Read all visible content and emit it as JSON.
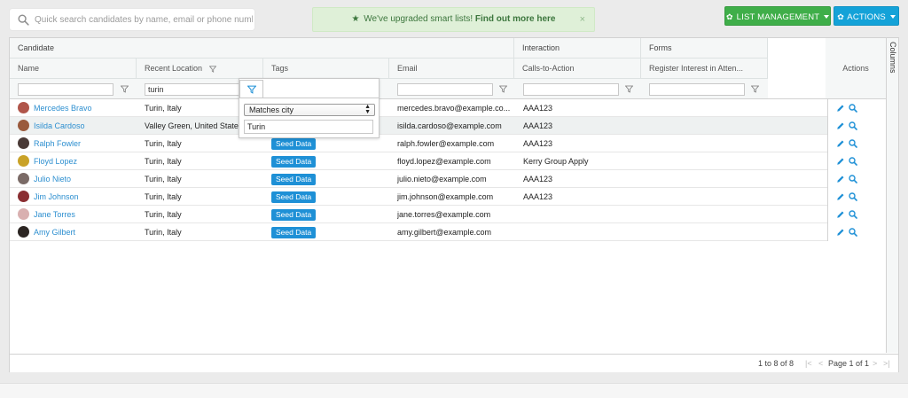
{
  "search": {
    "placeholder": "Quick search candidates by name, email or phone number",
    "icon": "search-icon"
  },
  "banner": {
    "text": "We've upgraded smart lists!",
    "link": "Find out more here",
    "close": "×"
  },
  "buttons": {
    "list_management": "LIST MANAGEMENT",
    "actions": "ACTIONS"
  },
  "colors": {
    "green": "#3fae49",
    "blue": "#14a2d8",
    "link": "#2d8fd0",
    "tag": "#1e90d6"
  },
  "grid": {
    "groups": {
      "candidate": "Candidate",
      "interaction": "Interaction",
      "forms": "Forms"
    },
    "columns": {
      "name": "Name",
      "location": "Recent Location",
      "tags": "Tags",
      "email": "Email",
      "cta": "Calls-to-Action",
      "forms": "Register Interest in Atten...",
      "actions": "Actions"
    },
    "columns_tab": "Columns",
    "filters": {
      "name": "",
      "location": "turin",
      "email": "",
      "cta": "",
      "forms": ""
    },
    "popup": {
      "operator": "Matches city",
      "value": "Turin"
    },
    "rows": [
      {
        "name": "Mercedes Bravo",
        "location": "Turin, Italy",
        "tag": "",
        "email": "mercedes.bravo@example.co...",
        "cta": "AAA123",
        "avatar": "#b0554a"
      },
      {
        "name": "Isilda Cardoso",
        "location": "Valley Green, United States",
        "tag": "",
        "email": "isilda.cardoso@example.com",
        "cta": "AAA123",
        "avatar": "#9a5a3c"
      },
      {
        "name": "Ralph Fowler",
        "location": "Turin, Italy",
        "tag": "Seed Data",
        "email": "ralph.fowler@example.com",
        "cta": "AAA123",
        "avatar": "#4a3a36"
      },
      {
        "name": "Floyd Lopez",
        "location": "Turin, Italy",
        "tag": "Seed Data",
        "email": "floyd.lopez@example.com",
        "cta": "Kerry Group Apply",
        "avatar": "#c9a227"
      },
      {
        "name": "Julio Nieto",
        "location": "Turin, Italy",
        "tag": "Seed Data",
        "email": "julio.nieto@example.com",
        "cta": "AAA123",
        "avatar": "#7a6a66"
      },
      {
        "name": "Jim Johnson",
        "location": "Turin, Italy",
        "tag": "Seed Data",
        "email": "jim.johnson@example.com",
        "cta": "AAA123",
        "avatar": "#8a2e32"
      },
      {
        "name": "Jane Torres",
        "location": "Turin, Italy",
        "tag": "Seed Data",
        "email": "jane.torres@example.com",
        "cta": "",
        "avatar": "#d9b0b0"
      },
      {
        "name": "Amy Gilbert",
        "location": "Turin, Italy",
        "tag": "Seed Data",
        "email": "amy.gilbert@example.com",
        "cta": "",
        "avatar": "#2b2522"
      }
    ]
  },
  "footer": {
    "count": "1 to 8 of 8",
    "page": "Page 1 of 1",
    "first": "|<",
    "prev": "<",
    "next": ">",
    "last": ">|"
  }
}
